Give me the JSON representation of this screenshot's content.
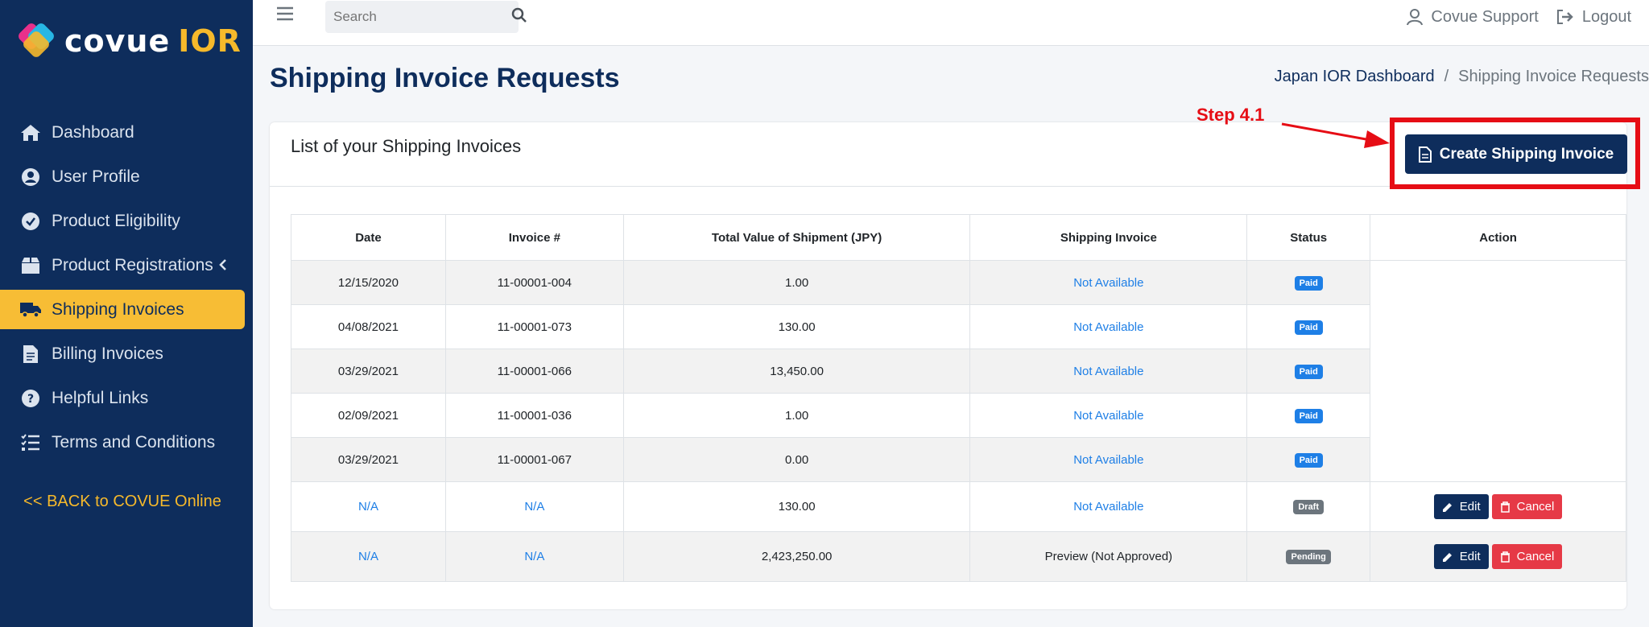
{
  "brand": {
    "name": "covue",
    "suffix": "IOR"
  },
  "sidebar": {
    "items": [
      {
        "label": "Dashboard",
        "icon": "home-icon"
      },
      {
        "label": "User Profile",
        "icon": "user-circle-icon"
      },
      {
        "label": "Product Eligibility",
        "icon": "check-circle-icon"
      },
      {
        "label": "Product Registrations",
        "icon": "box-icon"
      },
      {
        "label": "Shipping Invoices",
        "icon": "truck-icon",
        "active": true
      },
      {
        "label": "Billing Invoices",
        "icon": "file-icon"
      },
      {
        "label": "Helpful Links",
        "icon": "question-circle-icon"
      },
      {
        "label": "Terms and Conditions",
        "icon": "list-check-icon"
      }
    ],
    "back_link": "<< BACK to COVUE Online"
  },
  "topbar": {
    "search_placeholder": "Search",
    "support_label": "Covue Support",
    "logout_label": "Logout"
  },
  "page": {
    "title": "Shipping Invoice Requests",
    "breadcrumb": {
      "parent": "Japan IOR Dashboard",
      "separator": "/",
      "current": "Shipping Invoice Requests"
    }
  },
  "card": {
    "title": "List of your Shipping Invoices",
    "create_button": "Create Shipping Invoice"
  },
  "annotation": {
    "label": "Step 4.1",
    "color": "#e60d15"
  },
  "table": {
    "headers": [
      "Date",
      "Invoice #",
      "Total Value of Shipment (JPY)",
      "Shipping Invoice",
      "Status",
      "Action"
    ],
    "rows": [
      {
        "date": "12/15/2020",
        "invoice": "11-00001-004",
        "total": "1.00",
        "shipping_invoice": "Not Available",
        "status": "Paid"
      },
      {
        "date": "04/08/2021",
        "invoice": "11-00001-073",
        "total": "130.00",
        "shipping_invoice": "Not Available",
        "status": "Paid"
      },
      {
        "date": "03/29/2021",
        "invoice": "11-00001-066",
        "total": "13,450.00",
        "shipping_invoice": "Not Available",
        "status": "Paid"
      },
      {
        "date": "02/09/2021",
        "invoice": "11-00001-036",
        "total": "1.00",
        "shipping_invoice": "Not Available",
        "status": "Paid"
      },
      {
        "date": "03/29/2021",
        "invoice": "11-00001-067",
        "total": "0.00",
        "shipping_invoice": "Not Available",
        "status": "Paid"
      },
      {
        "date": "N/A",
        "invoice": "N/A",
        "total": "130.00",
        "shipping_invoice": "Not Available",
        "status": "Draft",
        "edit": "Edit",
        "cancel": "Cancel"
      },
      {
        "date": "N/A",
        "invoice": "N/A",
        "total": "2,423,250.00",
        "shipping_invoice": "Preview (Not Approved)",
        "status": "Pending",
        "edit": "Edit",
        "cancel": "Cancel"
      }
    ]
  },
  "colors": {
    "navy": "#0e2d5c",
    "accent": "#f7bd35",
    "link": "#1e7fe6",
    "danger": "#e63946"
  }
}
